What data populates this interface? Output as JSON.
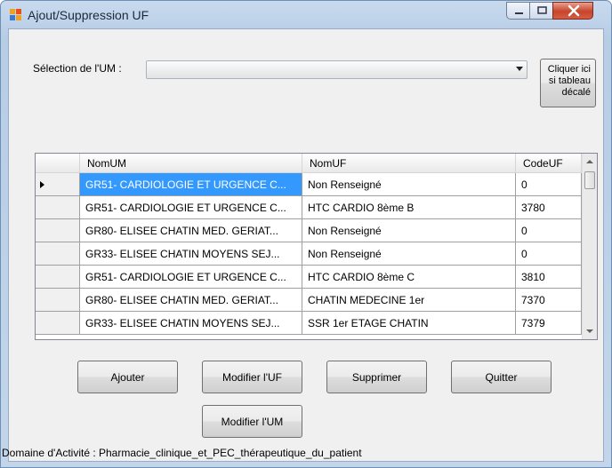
{
  "window": {
    "title": "Ajout/Suppression UF"
  },
  "um_selector": {
    "label": "Sélection de l'UM :",
    "value": ""
  },
  "shifted_table_button": {
    "line1": "Cliquer ici",
    "line2": "si tableau",
    "line3": "décalé"
  },
  "grid": {
    "columns": [
      "NomUM",
      "NomUF",
      "CodeUF"
    ],
    "rows": [
      [
        "GR51- CARDIOLOGIE ET URGENCE C...",
        "Non Renseigné",
        "0"
      ],
      [
        "GR51- CARDIOLOGIE ET URGENCE C...",
        "HTC CARDIO 8ème B",
        "3780"
      ],
      [
        "GR80- ELISEE CHATIN MED. GERIAT...",
        "Non Renseigné",
        "0"
      ],
      [
        "GR33- ELISEE CHATIN MOYENS SEJ...",
        "Non Renseigné",
        "0"
      ],
      [
        "GR51- CARDIOLOGIE ET URGENCE C...",
        "HTC CARDIO 8ème C",
        "3810"
      ],
      [
        "GR80- ELISEE CHATIN MED. GERIAT...",
        "CHATIN MEDECINE 1er",
        "7370"
      ],
      [
        "GR33- ELISEE CHATIN MOYENS SEJ...",
        "SSR 1er ETAGE CHATIN",
        "7379"
      ]
    ],
    "selected_row": 0
  },
  "buttons": {
    "add": "Ajouter",
    "modify_uf": "Modifier l'UF",
    "delete": "Supprimer",
    "quit": "Quitter",
    "modify_um": "Modifier l'UM"
  },
  "status": {
    "text": "Domaine d'Activité :  Pharmacie_clinique_et_PEC_thérapeutique_du_patient"
  }
}
